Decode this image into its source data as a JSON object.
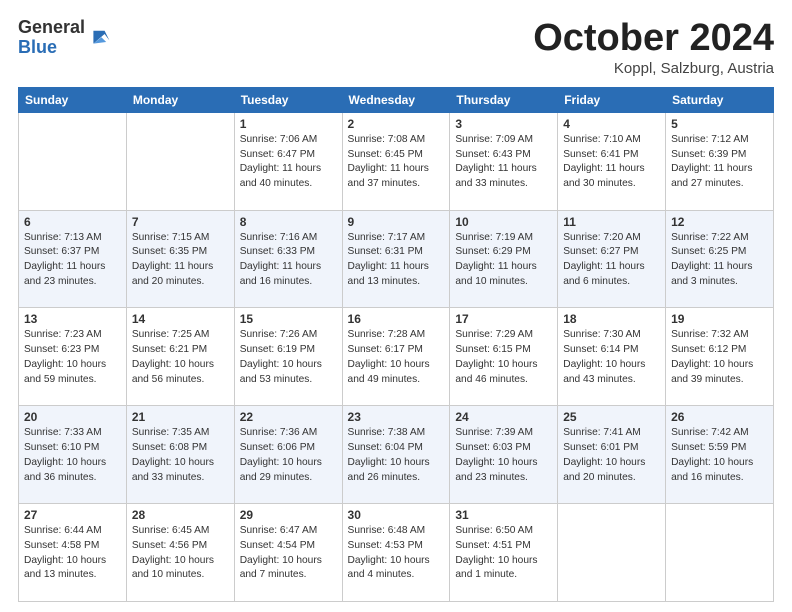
{
  "header": {
    "logo_general": "General",
    "logo_blue": "Blue",
    "month_title": "October 2024",
    "location": "Koppl, Salzburg, Austria"
  },
  "days_of_week": [
    "Sunday",
    "Monday",
    "Tuesday",
    "Wednesday",
    "Thursday",
    "Friday",
    "Saturday"
  ],
  "weeks": [
    [
      {
        "day": "",
        "sunrise": "",
        "sunset": "",
        "daylight": ""
      },
      {
        "day": "",
        "sunrise": "",
        "sunset": "",
        "daylight": ""
      },
      {
        "day": "1",
        "sunrise": "Sunrise: 7:06 AM",
        "sunset": "Sunset: 6:47 PM",
        "daylight": "Daylight: 11 hours and 40 minutes."
      },
      {
        "day": "2",
        "sunrise": "Sunrise: 7:08 AM",
        "sunset": "Sunset: 6:45 PM",
        "daylight": "Daylight: 11 hours and 37 minutes."
      },
      {
        "day": "3",
        "sunrise": "Sunrise: 7:09 AM",
        "sunset": "Sunset: 6:43 PM",
        "daylight": "Daylight: 11 hours and 33 minutes."
      },
      {
        "day": "4",
        "sunrise": "Sunrise: 7:10 AM",
        "sunset": "Sunset: 6:41 PM",
        "daylight": "Daylight: 11 hours and 30 minutes."
      },
      {
        "day": "5",
        "sunrise": "Sunrise: 7:12 AM",
        "sunset": "Sunset: 6:39 PM",
        "daylight": "Daylight: 11 hours and 27 minutes."
      }
    ],
    [
      {
        "day": "6",
        "sunrise": "Sunrise: 7:13 AM",
        "sunset": "Sunset: 6:37 PM",
        "daylight": "Daylight: 11 hours and 23 minutes."
      },
      {
        "day": "7",
        "sunrise": "Sunrise: 7:15 AM",
        "sunset": "Sunset: 6:35 PM",
        "daylight": "Daylight: 11 hours and 20 minutes."
      },
      {
        "day": "8",
        "sunrise": "Sunrise: 7:16 AM",
        "sunset": "Sunset: 6:33 PM",
        "daylight": "Daylight: 11 hours and 16 minutes."
      },
      {
        "day": "9",
        "sunrise": "Sunrise: 7:17 AM",
        "sunset": "Sunset: 6:31 PM",
        "daylight": "Daylight: 11 hours and 13 minutes."
      },
      {
        "day": "10",
        "sunrise": "Sunrise: 7:19 AM",
        "sunset": "Sunset: 6:29 PM",
        "daylight": "Daylight: 11 hours and 10 minutes."
      },
      {
        "day": "11",
        "sunrise": "Sunrise: 7:20 AM",
        "sunset": "Sunset: 6:27 PM",
        "daylight": "Daylight: 11 hours and 6 minutes."
      },
      {
        "day": "12",
        "sunrise": "Sunrise: 7:22 AM",
        "sunset": "Sunset: 6:25 PM",
        "daylight": "Daylight: 11 hours and 3 minutes."
      }
    ],
    [
      {
        "day": "13",
        "sunrise": "Sunrise: 7:23 AM",
        "sunset": "Sunset: 6:23 PM",
        "daylight": "Daylight: 10 hours and 59 minutes."
      },
      {
        "day": "14",
        "sunrise": "Sunrise: 7:25 AM",
        "sunset": "Sunset: 6:21 PM",
        "daylight": "Daylight: 10 hours and 56 minutes."
      },
      {
        "day": "15",
        "sunrise": "Sunrise: 7:26 AM",
        "sunset": "Sunset: 6:19 PM",
        "daylight": "Daylight: 10 hours and 53 minutes."
      },
      {
        "day": "16",
        "sunrise": "Sunrise: 7:28 AM",
        "sunset": "Sunset: 6:17 PM",
        "daylight": "Daylight: 10 hours and 49 minutes."
      },
      {
        "day": "17",
        "sunrise": "Sunrise: 7:29 AM",
        "sunset": "Sunset: 6:15 PM",
        "daylight": "Daylight: 10 hours and 46 minutes."
      },
      {
        "day": "18",
        "sunrise": "Sunrise: 7:30 AM",
        "sunset": "Sunset: 6:14 PM",
        "daylight": "Daylight: 10 hours and 43 minutes."
      },
      {
        "day": "19",
        "sunrise": "Sunrise: 7:32 AM",
        "sunset": "Sunset: 6:12 PM",
        "daylight": "Daylight: 10 hours and 39 minutes."
      }
    ],
    [
      {
        "day": "20",
        "sunrise": "Sunrise: 7:33 AM",
        "sunset": "Sunset: 6:10 PM",
        "daylight": "Daylight: 10 hours and 36 minutes."
      },
      {
        "day": "21",
        "sunrise": "Sunrise: 7:35 AM",
        "sunset": "Sunset: 6:08 PM",
        "daylight": "Daylight: 10 hours and 33 minutes."
      },
      {
        "day": "22",
        "sunrise": "Sunrise: 7:36 AM",
        "sunset": "Sunset: 6:06 PM",
        "daylight": "Daylight: 10 hours and 29 minutes."
      },
      {
        "day": "23",
        "sunrise": "Sunrise: 7:38 AM",
        "sunset": "Sunset: 6:04 PM",
        "daylight": "Daylight: 10 hours and 26 minutes."
      },
      {
        "day": "24",
        "sunrise": "Sunrise: 7:39 AM",
        "sunset": "Sunset: 6:03 PM",
        "daylight": "Daylight: 10 hours and 23 minutes."
      },
      {
        "day": "25",
        "sunrise": "Sunrise: 7:41 AM",
        "sunset": "Sunset: 6:01 PM",
        "daylight": "Daylight: 10 hours and 20 minutes."
      },
      {
        "day": "26",
        "sunrise": "Sunrise: 7:42 AM",
        "sunset": "Sunset: 5:59 PM",
        "daylight": "Daylight: 10 hours and 16 minutes."
      }
    ],
    [
      {
        "day": "27",
        "sunrise": "Sunrise: 6:44 AM",
        "sunset": "Sunset: 4:58 PM",
        "daylight": "Daylight: 10 hours and 13 minutes."
      },
      {
        "day": "28",
        "sunrise": "Sunrise: 6:45 AM",
        "sunset": "Sunset: 4:56 PM",
        "daylight": "Daylight: 10 hours and 10 minutes."
      },
      {
        "day": "29",
        "sunrise": "Sunrise: 6:47 AM",
        "sunset": "Sunset: 4:54 PM",
        "daylight": "Daylight: 10 hours and 7 minutes."
      },
      {
        "day": "30",
        "sunrise": "Sunrise: 6:48 AM",
        "sunset": "Sunset: 4:53 PM",
        "daylight": "Daylight: 10 hours and 4 minutes."
      },
      {
        "day": "31",
        "sunrise": "Sunrise: 6:50 AM",
        "sunset": "Sunset: 4:51 PM",
        "daylight": "Daylight: 10 hours and 1 minute."
      },
      {
        "day": "",
        "sunrise": "",
        "sunset": "",
        "daylight": ""
      },
      {
        "day": "",
        "sunrise": "",
        "sunset": "",
        "daylight": ""
      }
    ]
  ]
}
